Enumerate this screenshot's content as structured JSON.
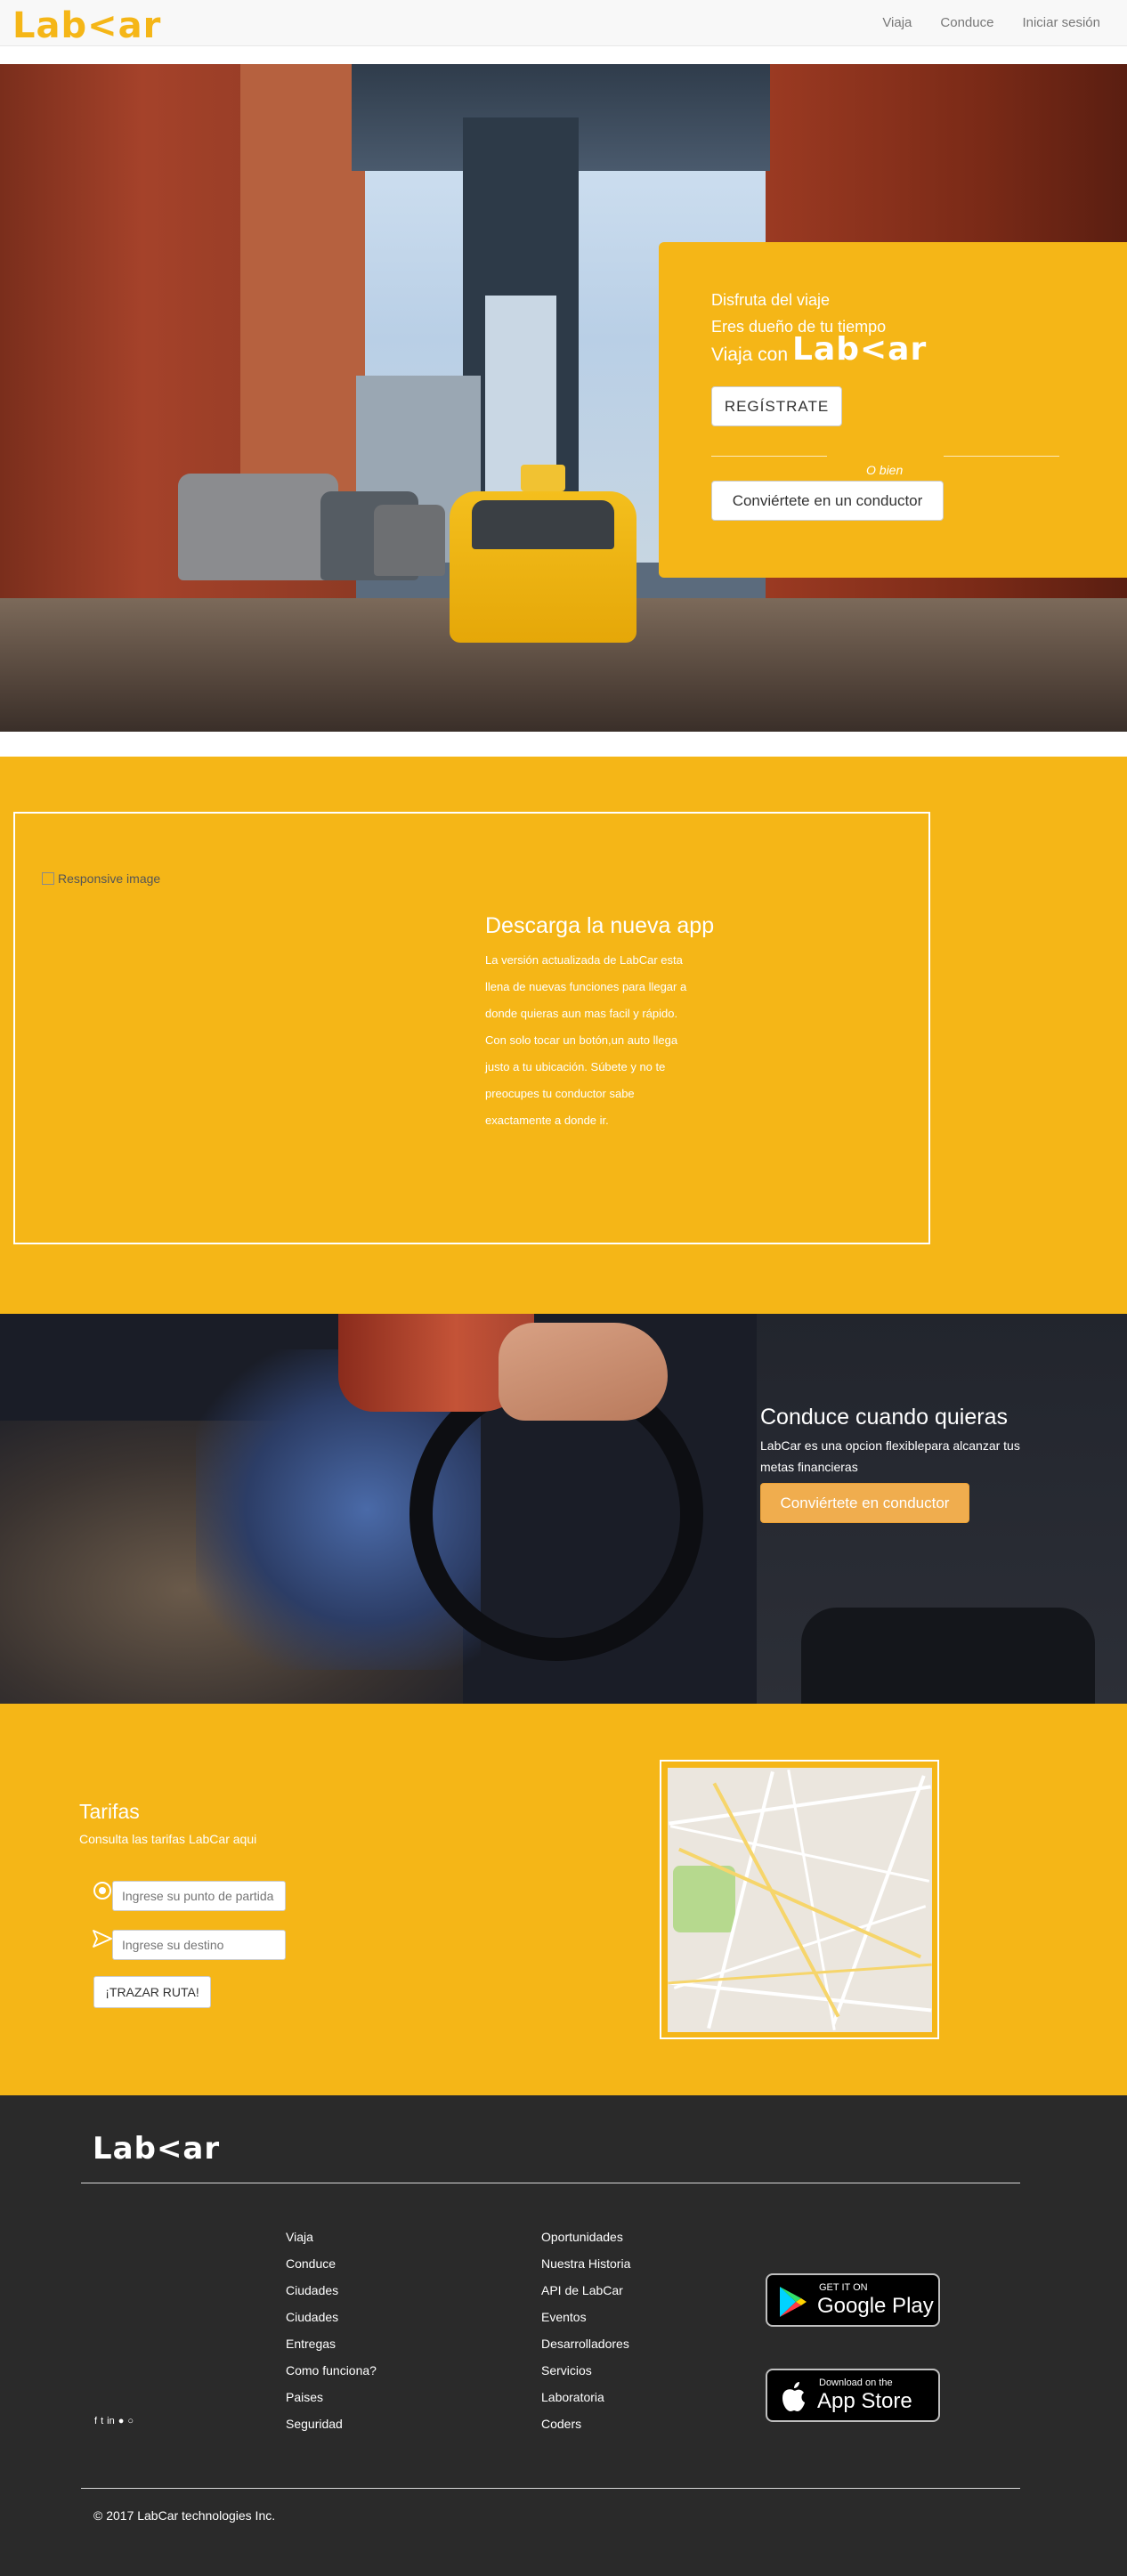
{
  "navbar": {
    "brand": "Lab<ar",
    "links": [
      "Viaja",
      "Conduce",
      "Iniciar sesión"
    ]
  },
  "hero": {
    "line1": "Disfruta del viaje",
    "line2": "Eres dueño de tu tiempo",
    "line3": "Viaja con",
    "logo": "Lab<ar",
    "register_button": "REGÍSTRATE",
    "or_text": "O bien",
    "driver_button": "Conviértete en un conductor"
  },
  "app_section": {
    "image_alt": "Responsive image",
    "title": "Descarga la nueva app",
    "paragraph1": "La versión actualizada de LabCar esta llena de nuevas funciones para llegar a donde quieras aun mas facil y rápido.",
    "paragraph2": "Con solo tocar un botón,un auto llega justo a tu ubicación. Súbete y no te preocupes tu conductor sabe exactamente a donde ir."
  },
  "drive_section": {
    "title": "Conduce cuando quieras",
    "paragraph": "LabCar es una opcion flexiblepara alcanzar tus metas financieras",
    "button": "Conviértete en conductor"
  },
  "fares": {
    "title": "Tarifas",
    "subtitle": "Consulta las tarifas LabCar aqui",
    "start_placeholder": "Ingrese su punto de partida",
    "destination_placeholder": "Ingrese su destino",
    "route_button": "¡TRAZAR RUTA!"
  },
  "footer": {
    "logo": "Lab<ar",
    "column_a": [
      "Viaja",
      "Conduce",
      "Ciudades",
      "Ciudades",
      "Entregas",
      "Como funciona?",
      "Paises",
      "Seguridad"
    ],
    "column_b": [
      "Oportunidades",
      "Nuestra Historia",
      "API de LabCar",
      "Eventos",
      "Desarrolladores",
      "Servicios",
      "Laboratoria",
      "Coders"
    ],
    "social_icons": [
      "facebook-icon",
      "twitter-icon",
      "linkedin-icon",
      "apple-icon",
      "opera-icon"
    ],
    "google_play": {
      "small": "GET IT ON",
      "big": "Google Play"
    },
    "app_store": {
      "small": "Download on the",
      "big": "App Store"
    },
    "copyright": "© 2017 LabCar technologies Inc."
  },
  "colors": {
    "brand_yellow": "#f5b617",
    "footer_dark": "#2a2a2a",
    "orange_button": "#f0ad4e"
  }
}
